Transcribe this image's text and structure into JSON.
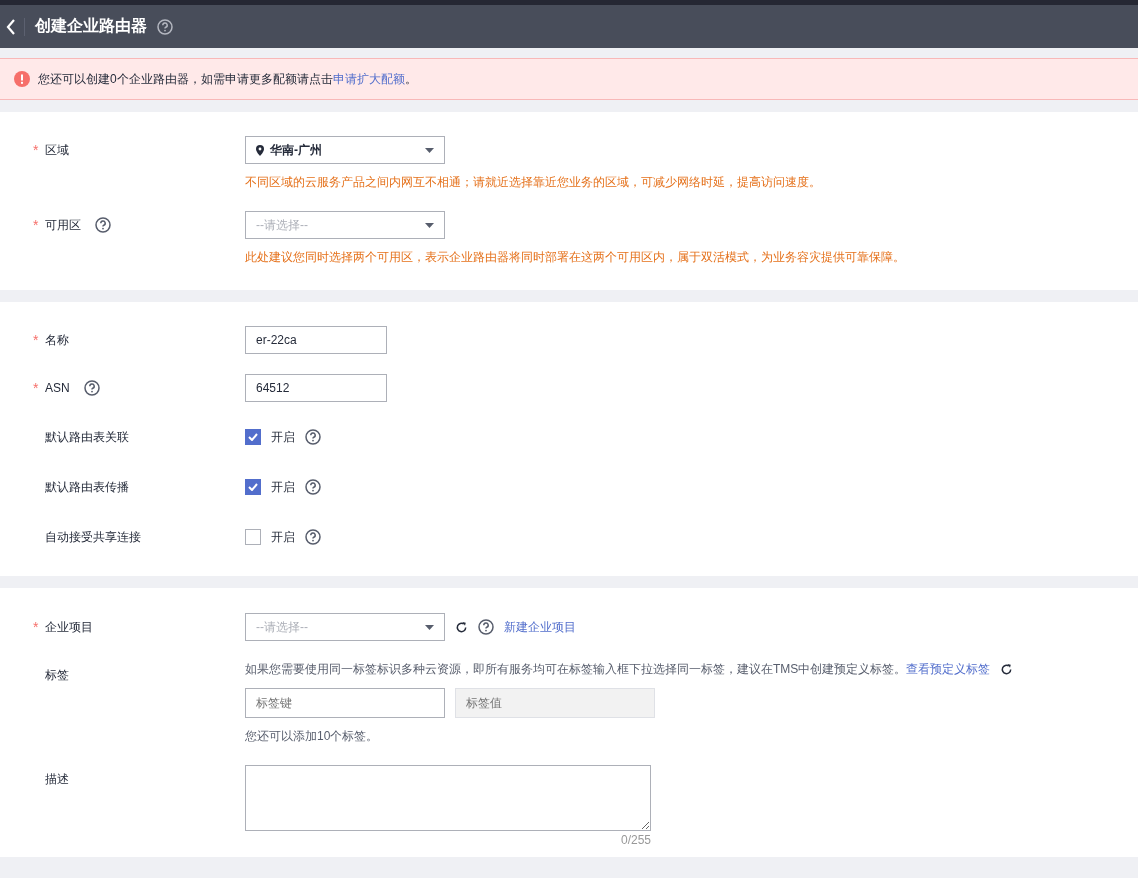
{
  "header": {
    "title": "创建企业路由器"
  },
  "alert": {
    "text": "您还可以创建0个企业路由器，如需申请更多配额请点击",
    "link": "申请扩大配额",
    "tail": "。"
  },
  "sections": [
    {
      "fields": [
        {
          "kind": "select",
          "label": "区域",
          "mark": "*",
          "help": false,
          "value": "华南-广州",
          "hint": "不同区域的云服务产品之间内网互不相通；请就近选择靠近您业务的区域，可减少网络时延，提高访问速度。"
        },
        {
          "kind": "select",
          "label": "可用区",
          "mark": "*",
          "help": true,
          "placeholder": "--请选择--",
          "hint": "此处建议您同时选择两个可用区，表示企业路由器将同时部署在这两个可用区内，属于双活模式，为业务容灾提供可靠保障。"
        }
      ]
    },
    {
      "fields": [
        {
          "kind": "text",
          "label": "名称",
          "mark": "*",
          "help": false,
          "value": "er-22ca"
        },
        {
          "kind": "text",
          "label": "ASN",
          "mark": "*",
          "help": true,
          "value": "64512"
        },
        {
          "kind": "checkbox",
          "label": "默认路由表关联",
          "help": false,
          "checked": true,
          "option": "开启"
        },
        {
          "kind": "checkbox",
          "label": "默认路由表传播",
          "help": false,
          "checked": true,
          "option": "开启"
        },
        {
          "kind": "checkbox",
          "label": "自动接受共享连接",
          "help": false,
          "checked": false,
          "option": "开启"
        }
      ]
    },
    {
      "fields": [
        {
          "kind": "project",
          "label": "企业项目",
          "mark": "*",
          "help": false,
          "placeholder": "--请选择--",
          "link": "新建企业项目"
        },
        {
          "kind": "tags",
          "label": "标签",
          "help": false,
          "note": "如果您需要使用同一标签标识多种云资源，即所有服务均可在标签输入框下拉选择同一标签，建议在TMS中创建预定义标签。",
          "link": "查看预定义标签",
          "key_placeholder": "标签键",
          "value_placeholder": "标签值",
          "remaining": "您还可以添加10个标签。"
        },
        {
          "kind": "textarea",
          "label": "描述",
          "help": false,
          "counter": "0/255"
        }
      ]
    }
  ]
}
